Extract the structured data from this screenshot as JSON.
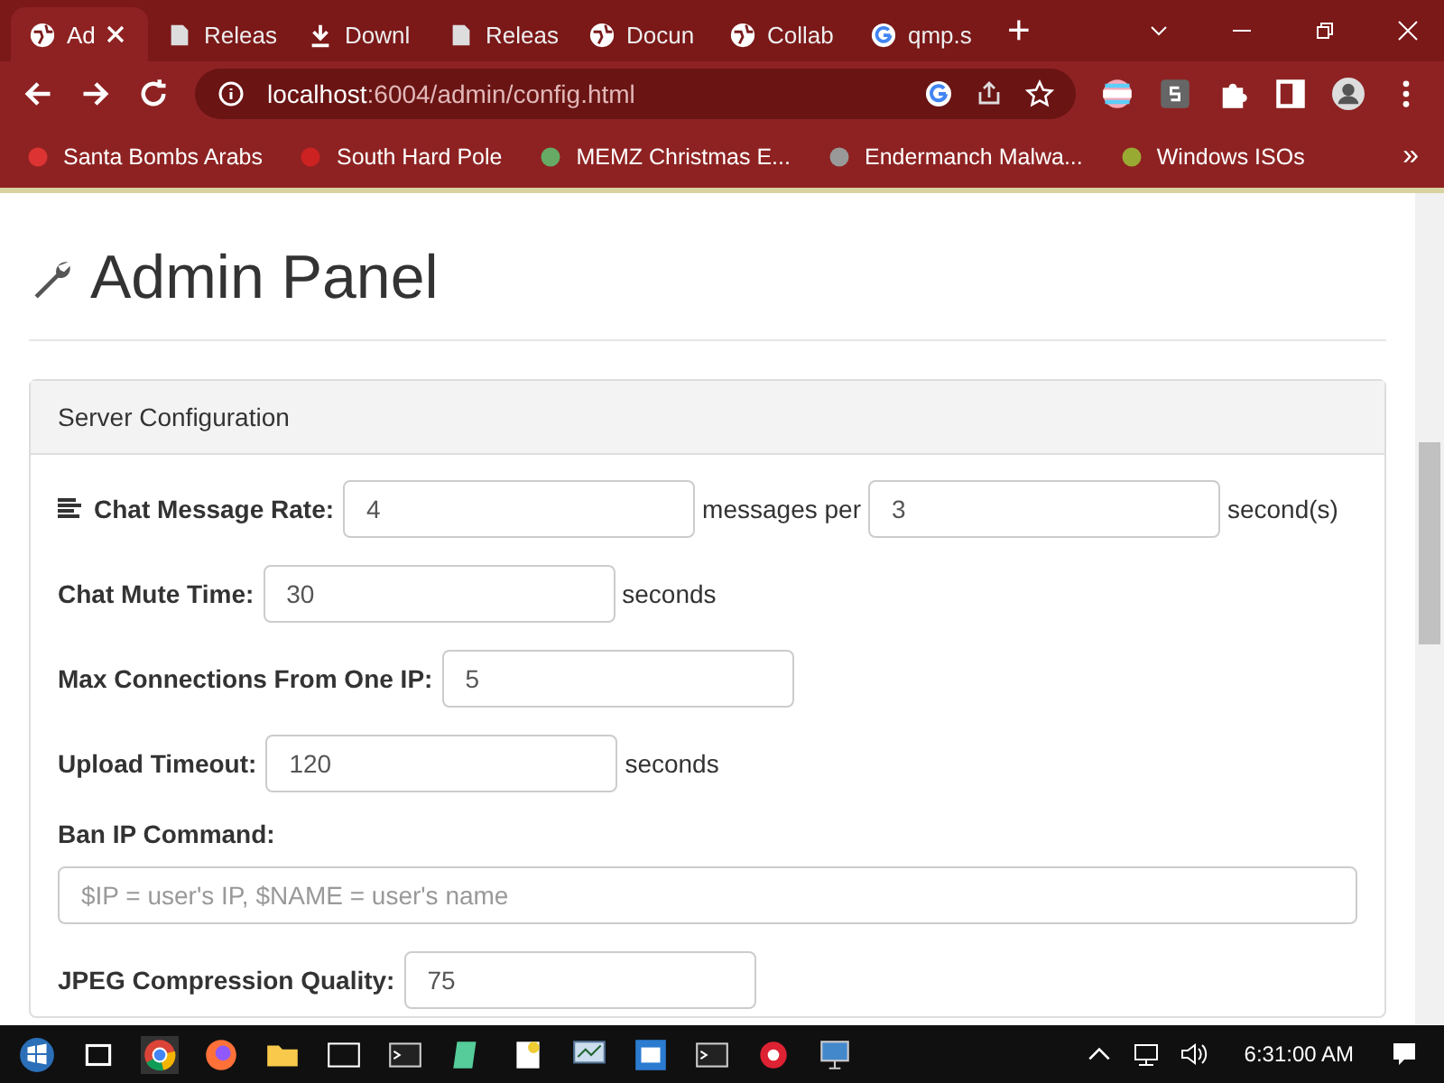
{
  "browser": {
    "tabs": [
      {
        "label": "Ad",
        "selected": true,
        "kind": "web"
      },
      {
        "label": "Releas",
        "selected": false,
        "kind": "page"
      },
      {
        "label": "Downl",
        "selected": false,
        "kind": "download"
      },
      {
        "label": "Releas",
        "selected": false,
        "kind": "page"
      },
      {
        "label": "Docun",
        "selected": false,
        "kind": "web"
      },
      {
        "label": "Collab",
        "selected": false,
        "kind": "web"
      },
      {
        "label": "qmp.s",
        "selected": false,
        "kind": "search"
      }
    ],
    "new_tab": "+",
    "address": {
      "host": "localhost",
      "rest": ":6004/admin/config.html"
    },
    "bookmarks": [
      "Santa Bombs Arabs",
      "South Hard Pole",
      "MEMZ Christmas E...",
      "Endermanch Malwa...",
      "Windows ISOs"
    ],
    "more": "»"
  },
  "page": {
    "title": "Admin Panel",
    "panel_title": "Server Configuration",
    "rows": [
      {
        "kind": "rate",
        "label": "Chat Message Rate:",
        "value": "4",
        "middle": "messages per",
        "value2": "3",
        "suffix": "second(s)"
      },
      {
        "kind": "field",
        "label": "Chat Mute Time:",
        "value": "30",
        "suffix": "seconds"
      },
      {
        "kind": "field",
        "label": "Max Connections From One IP:",
        "value": "5"
      },
      {
        "kind": "field",
        "label": "Upload Timeout:",
        "value": "120",
        "suffix": "seconds"
      },
      {
        "kind": "block",
        "label": "Ban IP Command:",
        "placeholder": "$IP = user's IP, $NAME = user's name"
      },
      {
        "kind": "field",
        "label": "JPEG Compression Quality:",
        "value": "75"
      }
    ]
  },
  "taskbar": {
    "time": "6:31:00 AM"
  }
}
